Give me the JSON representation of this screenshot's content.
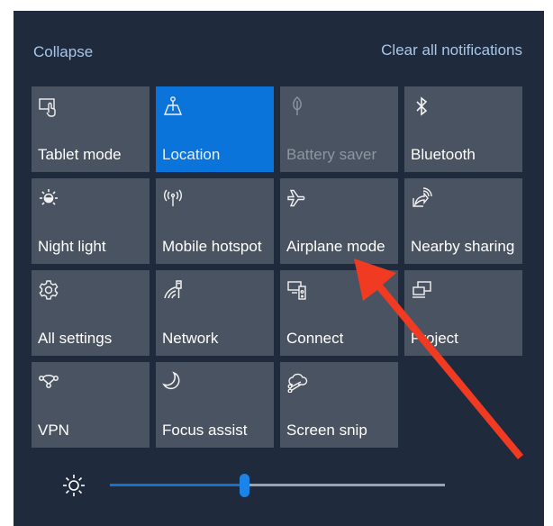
{
  "header": {
    "collapse_label": "Collapse",
    "clear_all_label": "Clear all notifications"
  },
  "tiles": [
    {
      "label": "Tablet mode",
      "icon": "tablet-mode-icon",
      "state": "off"
    },
    {
      "label": "Location",
      "icon": "location-icon",
      "state": "on"
    },
    {
      "label": "Battery saver",
      "icon": "battery-saver-icon",
      "state": "disabled"
    },
    {
      "label": "Bluetooth",
      "icon": "bluetooth-icon",
      "state": "off"
    },
    {
      "label": "Night light",
      "icon": "night-light-icon",
      "state": "off"
    },
    {
      "label": "Mobile hotspot",
      "icon": "mobile-hotspot-icon",
      "state": "off"
    },
    {
      "label": "Airplane mode",
      "icon": "airplane-icon",
      "state": "off"
    },
    {
      "label": "Nearby sharing",
      "icon": "nearby-sharing-icon",
      "state": "off"
    },
    {
      "label": "All settings",
      "icon": "gear-icon",
      "state": "off"
    },
    {
      "label": "Network",
      "icon": "network-icon",
      "state": "off"
    },
    {
      "label": "Connect",
      "icon": "connect-icon",
      "state": "off"
    },
    {
      "label": "Project",
      "icon": "project-icon",
      "state": "off"
    },
    {
      "label": "VPN",
      "icon": "vpn-icon",
      "state": "off"
    },
    {
      "label": "Focus assist",
      "icon": "moon-icon",
      "state": "off"
    },
    {
      "label": "Screen snip",
      "icon": "screen-snip-icon",
      "state": "off"
    }
  ],
  "brightness": {
    "icon": "brightness-icon",
    "value_percent": 40
  },
  "annotation": {
    "type": "arrow",
    "points_to": "Airplane mode",
    "color": "#f03a22"
  },
  "colors": {
    "panel_bg": "#1f2a3c",
    "tile_bg": "#4a5361",
    "active_tile_bg": "#0a74da",
    "link_color": "#a9c6e8",
    "slider_fill": "#1a6fc9"
  }
}
